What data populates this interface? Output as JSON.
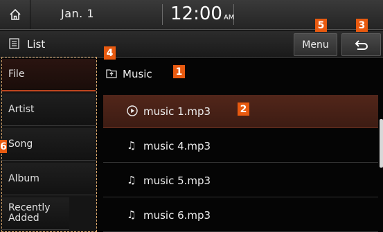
{
  "status_bar": {
    "home_icon": "home-icon",
    "date": "Jan.  1",
    "time": "12:00",
    "ampm": "AM"
  },
  "title_bar": {
    "list_icon": "list-icon",
    "list_label": "List",
    "menu_label": "Menu",
    "back_icon": "back-arrow-icon"
  },
  "sidebar": {
    "items": [
      {
        "label": "File",
        "active": true
      },
      {
        "label": "Artist",
        "active": false
      },
      {
        "label": "Song",
        "active": false
      },
      {
        "label": "Album",
        "active": false
      },
      {
        "label": "Recently Added",
        "active": false
      }
    ]
  },
  "main": {
    "folder": {
      "icon": "folder-up-icon",
      "label": "Music"
    },
    "tracks": [
      {
        "label": "music 1.mp3",
        "icon": "play-circle-icon",
        "active": true
      },
      {
        "label": "music 4.mp3",
        "icon": "music-note-icon",
        "active": false
      },
      {
        "label": "music 5.mp3",
        "icon": "music-note-icon",
        "active": false
      },
      {
        "label": "music 6.mp3",
        "icon": "music-note-icon",
        "active": false
      }
    ]
  },
  "callouts": [
    "1",
    "2",
    "3",
    "4",
    "5",
    "6"
  ],
  "colors": {
    "accent": "#c0451f",
    "badge": "#e85a10",
    "highlight": "#4a2218"
  }
}
